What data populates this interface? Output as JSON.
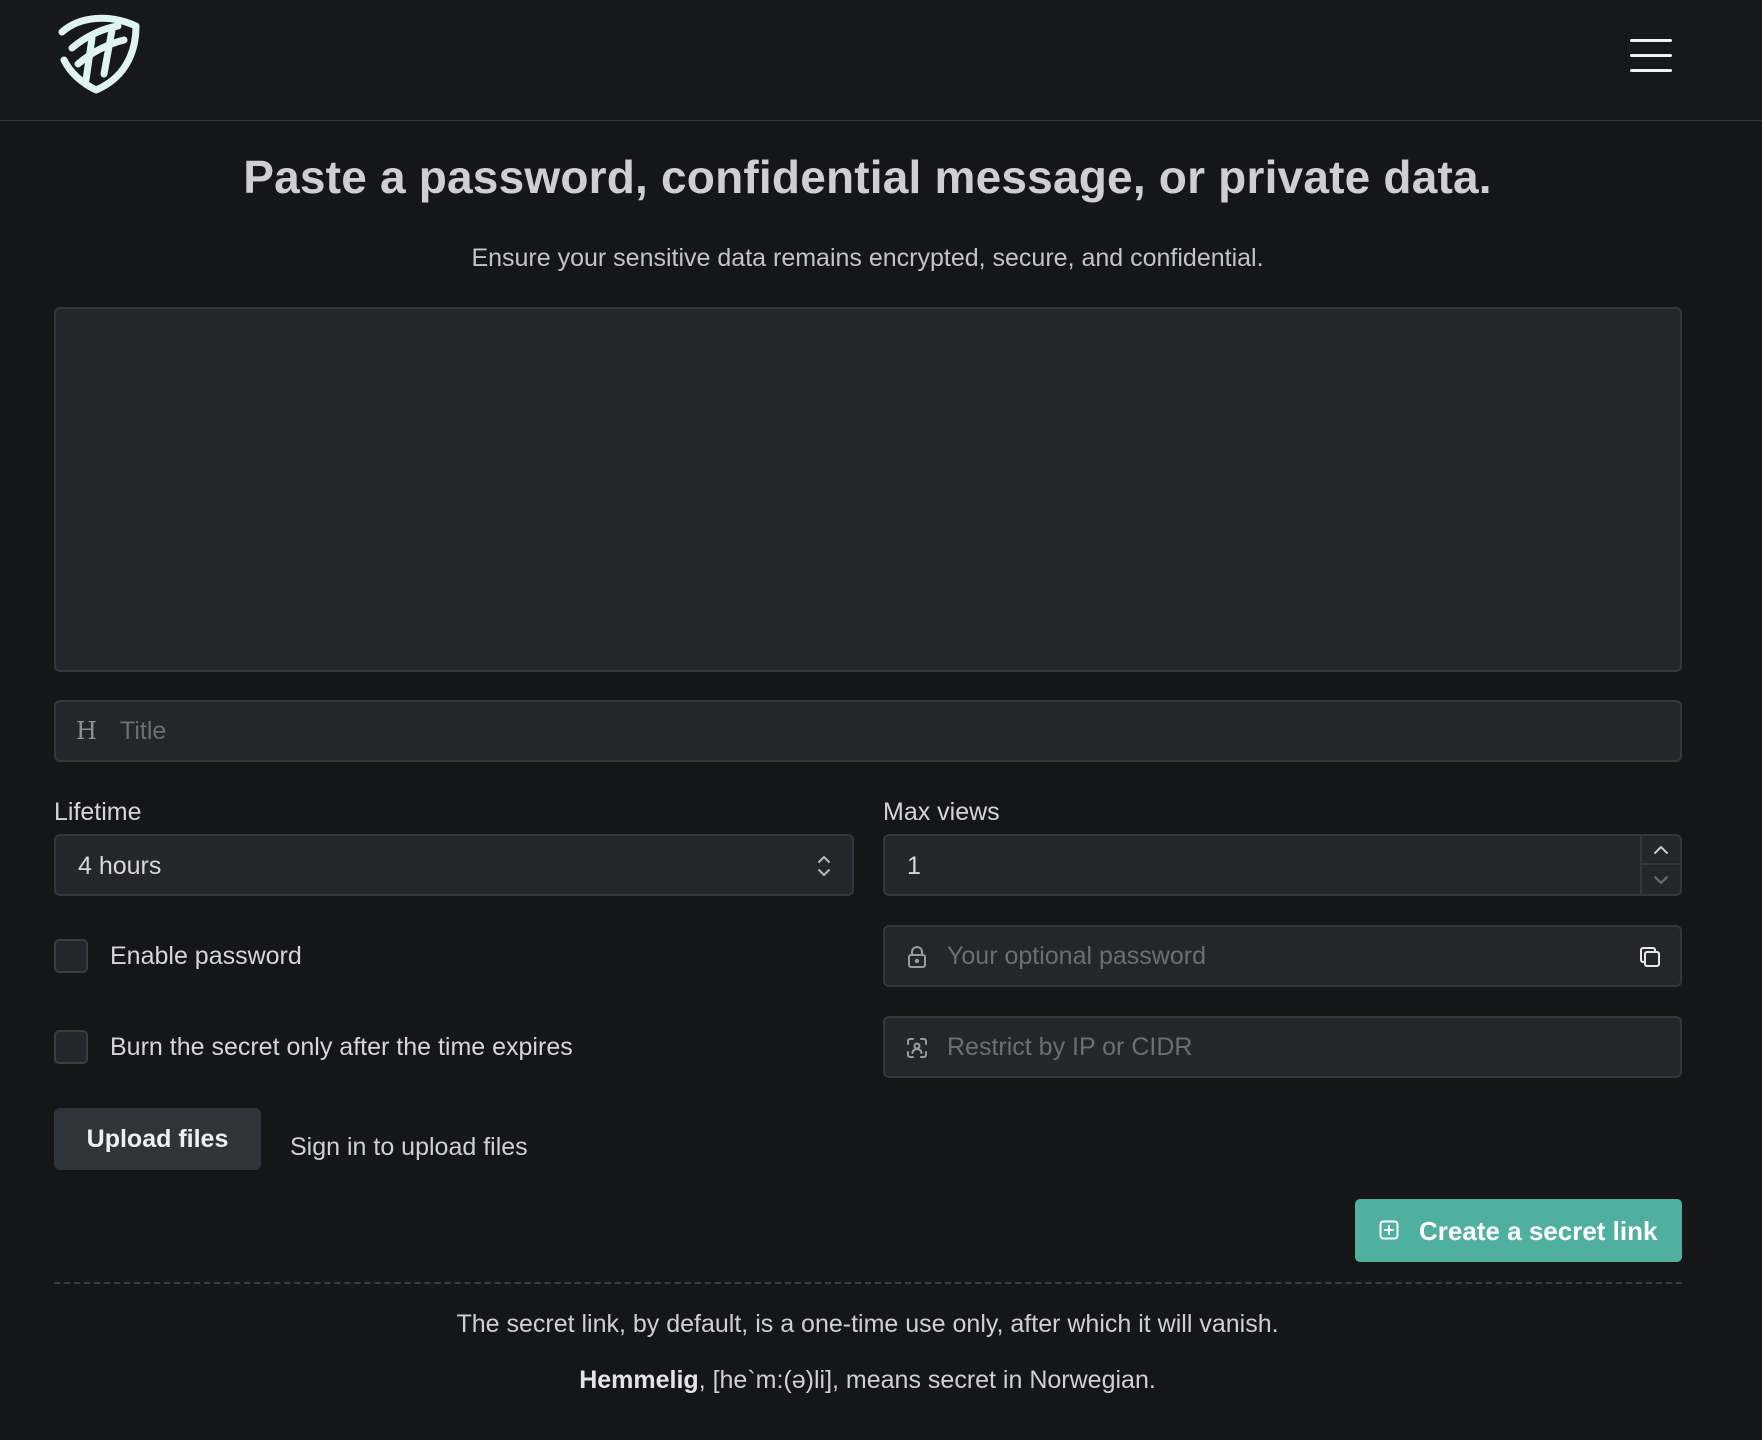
{
  "header": {
    "logo_icon": "shield-logo-icon",
    "menu_icon": "hamburger-menu-icon"
  },
  "hero": {
    "title": "Paste a password, confidential message, or private data.",
    "subtitle": "Ensure your sensitive data remains encrypted, secure, and confidential."
  },
  "form": {
    "secret_text": {
      "value": "",
      "placeholder": ""
    },
    "title_field": {
      "icon": "heading-icon",
      "value": "",
      "placeholder": "Title"
    },
    "lifetime": {
      "label": "Lifetime",
      "selected": "4 hours"
    },
    "max_views": {
      "label": "Max views",
      "value": "1"
    },
    "enable_password": {
      "label": "Enable password",
      "checked": false
    },
    "password_field": {
      "icon": "lock-icon",
      "placeholder": "Your optional password",
      "copy_icon": "copy-icon"
    },
    "burn_after_expiry": {
      "label": "Burn the secret only after the time expires",
      "checked": false
    },
    "ip_field": {
      "icon": "ip-scan-icon",
      "placeholder": "Restrict by IP or CIDR"
    },
    "upload_button": "Upload files",
    "signin_note": "Sign in to upload files",
    "create_button": "Create a secret link"
  },
  "footer": {
    "note": "The secret link, by default, is a one-time use only, after which it will vanish.",
    "brand": "Hemmelig",
    "meaning": ", [he`m:(ə)li], means secret in Norwegian."
  },
  "colors": {
    "background": "#151618",
    "field": "#25262b",
    "accent": "#4fb0a0",
    "button_dark": "#2f343b"
  }
}
